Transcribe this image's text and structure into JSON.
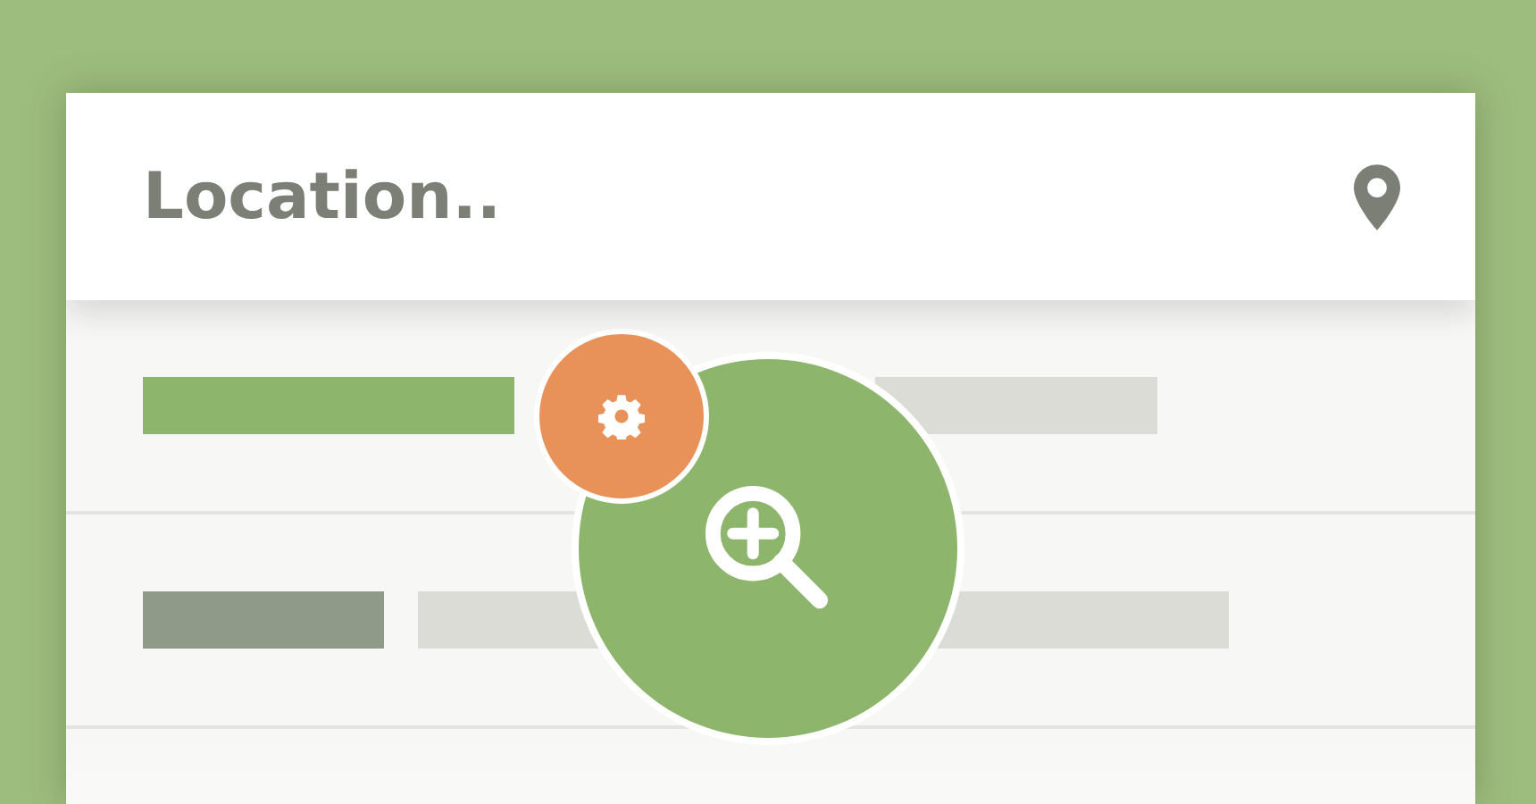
{
  "search": {
    "placeholder": "Location.."
  }
}
